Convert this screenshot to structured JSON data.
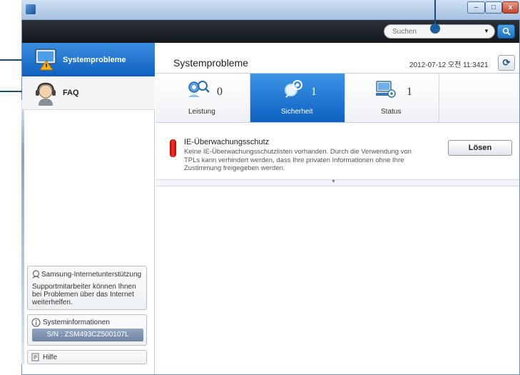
{
  "search": {
    "placeholder": "Suchen"
  },
  "window": {
    "minimize": "–",
    "maximize": "□",
    "close": "x"
  },
  "sidebar": {
    "items": [
      {
        "label": "Systemprobleme",
        "icon": "monitor-warning-icon",
        "selected": true
      },
      {
        "label": "FAQ",
        "icon": "headset-support-icon",
        "selected": false
      }
    ],
    "support": {
      "title": "Samsung-Internetunterstützung",
      "description": "Supportmitarbeiter können Ihnen bei Problemen über das Internet weiterhelfen."
    },
    "sysinfo": {
      "title": "Systeminformationen",
      "serial": "S/N : ZSM493CZ500107L"
    },
    "help": {
      "label": "Hilfe"
    }
  },
  "main": {
    "title": "Systemprobleme",
    "datetime": "2012-07-12 오전 11:3421",
    "tabs": [
      {
        "label": "Leistung",
        "count": "0",
        "icon": "performance-search-icon"
      },
      {
        "label": "Sicherheit",
        "count": "1",
        "icon": "security-icon",
        "selected": true
      },
      {
        "label": "Status",
        "count": "1",
        "icon": "status-computer-icon"
      }
    ],
    "issue": {
      "title": "IE-Überwachungsschutz",
      "description": "Keine IE-Überwachungsschutzlisten vorhanden. Durch die Verwendung von TPLs kann verhindert werden, dass Ihre privaten Informationen ohne Ihre Zustimmung freigegeben werden.",
      "action": "Lösen"
    }
  },
  "colors": {
    "accent": "#1a6fd0",
    "header": "#1b2026",
    "alert": "#d11a10"
  }
}
